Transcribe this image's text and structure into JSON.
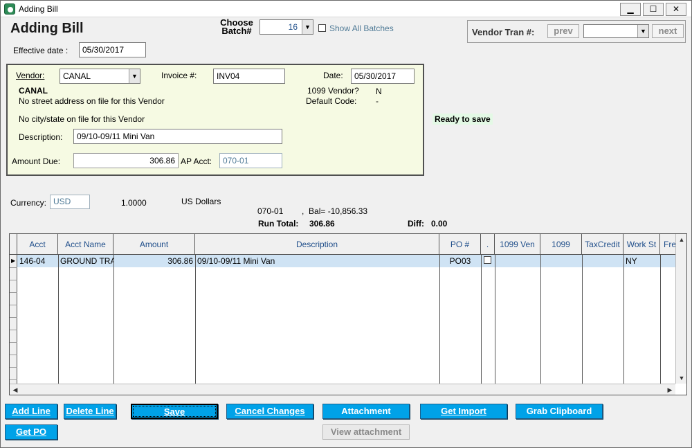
{
  "window": {
    "title": "Adding Bill",
    "minimize": "▁",
    "maximize": "☐",
    "close": "✕"
  },
  "header": {
    "heading": "Adding Bill",
    "batch_label_line1": "Choose",
    "batch_label_line2": "Batch#",
    "batch_value": "16",
    "show_all_batches": "Show All Batches",
    "effective_date_label": "Effective date :",
    "effective_date_value": "05/30/2017"
  },
  "vendor_tran": {
    "label": "Vendor Tran #:",
    "prev": "prev",
    "next": "next",
    "value": ""
  },
  "vendor_panel": {
    "vendor_label": "Vendor:",
    "vendor_value": "CANAL",
    "invoice_label": "Invoice #:",
    "invoice_value": "INV04",
    "date_label": "Date:",
    "date_value": "05/30/2017",
    "vendor_name": "CANAL",
    "address_line": "No street address on file for this Vendor",
    "city_line": "No city/state on file for this Vendor",
    "vendor_1099_label": "1099 Vendor?",
    "vendor_1099_value": "N",
    "default_code_label": "Default Code:",
    "default_code_value": "-",
    "description_label": "Description:",
    "description_value": "09/10-09/11 Mini Van",
    "amount_due_label": "Amount Due:",
    "amount_due_value": "306.86",
    "ap_acct_label": "AP Acct:",
    "ap_acct_value": "070-01"
  },
  "status": {
    "ready": "Ready to save"
  },
  "currency": {
    "label": "Currency:",
    "code": "USD",
    "rate": "1.0000",
    "name": "US Dollars",
    "acct_line": "070-01        ,  Bal= -10,856.33",
    "run_total_label": "Run Total:",
    "run_total_value": "306.86",
    "diff_label": "Diff:",
    "diff_value": "0.00"
  },
  "grid": {
    "columns": [
      "Acct",
      "Acct Name",
      "Amount",
      "Description",
      "PO #",
      ".",
      "1099 Ven",
      "1099",
      "TaxCredit",
      "Work St",
      "Fre"
    ],
    "rows": [
      {
        "acct": "146-04",
        "acct_name": "GROUND TRA",
        "amount": "306.86",
        "description": "09/10-09/11 Mini Van",
        "po": "PO03",
        "checked": false,
        "ven1099": "",
        "f1099": "",
        "taxcredit": "",
        "workst": "NY",
        "fre": ""
      }
    ]
  },
  "buttons": {
    "add_line": "Add Line",
    "delete_line": "Delete Line",
    "save": "Save",
    "cancel_changes": "Cancel Changes",
    "attachment": "Attachment",
    "get_import": "Get Import",
    "grab_clipboard": "Grab Clipboard",
    "get_po": "Get PO",
    "view_attachment": "View attachment"
  },
  "colors": {
    "accent_button": "#00a2e8",
    "panel_bg": "#f6fae3",
    "ready_bg": "#e3f9e5",
    "row_highlight": "#cfe3f4",
    "header_text": "#1f4e8a"
  }
}
